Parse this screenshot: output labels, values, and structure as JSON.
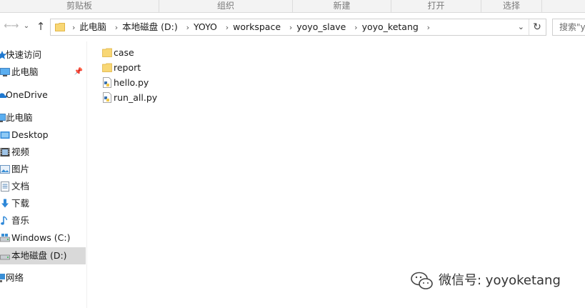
{
  "ribbon": {
    "groups": [
      "剪贴板",
      "组织",
      "新建",
      "打开",
      "选择"
    ]
  },
  "nav": {
    "back_icon": "back-arrow-icon",
    "forward_icon": "forward-arrow-icon",
    "history_icon": "chevron-down-icon",
    "up_icon": "up-arrow-icon"
  },
  "address": {
    "crumbs": [
      "此电脑",
      "本地磁盘 (D:)",
      "YOYO",
      "workspace",
      "yoyo_slave",
      "yoyo_ketang"
    ]
  },
  "search": {
    "placeholder": "搜索\"y"
  },
  "sidebar": {
    "items": [
      {
        "label": "快速访问",
        "icon": "star-icon"
      },
      {
        "label": "此电脑",
        "icon": "computer-icon",
        "pinned": true
      },
      {
        "label": "OneDrive",
        "icon": "cloud-icon"
      },
      {
        "label": "此电脑",
        "icon": "computer-icon"
      },
      {
        "label": "Desktop",
        "icon": "desktop-folder-icon"
      },
      {
        "label": "视频",
        "icon": "video-folder-icon"
      },
      {
        "label": "图片",
        "icon": "pictures-folder-icon"
      },
      {
        "label": "文档",
        "icon": "documents-folder-icon"
      },
      {
        "label": "下载",
        "icon": "download-arrow-icon"
      },
      {
        "label": "音乐",
        "icon": "music-note-icon"
      },
      {
        "label": "Windows (C:)",
        "icon": "drive-icon"
      },
      {
        "label": "本地磁盘 (D:)",
        "icon": "drive-icon",
        "selected": true
      },
      {
        "label": "网络",
        "icon": "network-icon"
      }
    ]
  },
  "files": [
    {
      "name": "case",
      "icon": "folder-icon"
    },
    {
      "name": "report",
      "icon": "folder-icon"
    },
    {
      "name": "hello.py",
      "icon": "python-file-icon"
    },
    {
      "name": "run_all.py",
      "icon": "python-file-icon"
    }
  ],
  "watermark": {
    "text": "微信号: yoyoketang"
  },
  "colors": {
    "selected_bg": "#d9d9d9",
    "folder_yellow": "#f8d775",
    "accent_blue": "#1e78d0"
  }
}
